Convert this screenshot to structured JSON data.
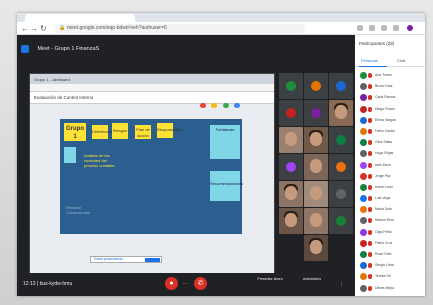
{
  "browser": {
    "url": "meet.google.com/eqp-bdwd-heh?authuser=0",
    "tab_title": "Meet - Grupo 1 FinanzaS"
  },
  "meet": {
    "title": "Meet - Grupo 1 FinanzaS",
    "meeting_code": "12:13 | bus-kydw-hmu",
    "controls": {
      "mic_icon": "mic-off-icon",
      "leave_icon": "call-end-icon",
      "cam_icon": "videocam-off-icon",
      "present_label": "Presentar ahora",
      "activities_label": "Actividades"
    },
    "shared_doc": {
      "window_title": "Grupo 1 - Jamboard",
      "doc_title": "Evaluación de Control Interno"
    },
    "board": {
      "group_label": "Grupo 1",
      "notes": [
        "Deficiencias",
        "Riesgos",
        "Plan de acción",
        "Responsables"
      ],
      "body_lines": [
        "Análisis de los",
        "controles del",
        "proceso contable"
      ],
      "footer_lines": [
        "Revisión",
        "Conclusiones"
      ],
      "right_panel_top": "Fortalezas",
      "right_panel_bottom": "Recomendaciones"
    },
    "share_bar": {
      "text": "Estás presentando",
      "stop_label": "Dejar"
    }
  },
  "participants": {
    "header": "Participantes (28)",
    "tabs": [
      "Personas",
      "Chat"
    ],
    "list": [
      {
        "name": "Ana Torres",
        "color": "#1e8e3e"
      },
      {
        "name": "Bruno Díaz",
        "color": "#5f6368"
      },
      {
        "name": "Carla Ramos",
        "color": "#7b1fa2"
      },
      {
        "name": "Diego Flores",
        "color": "#c5221f"
      },
      {
        "name": "Elena Vargas",
        "color": "#1967d2"
      },
      {
        "name": "Fabio Castro",
        "color": "#e37400"
      },
      {
        "name": "Gina Salas",
        "color": "#0b8043"
      },
      {
        "name": "Hugo Rojas",
        "color": "#5f6368"
      },
      {
        "name": "Inés Mora",
        "color": "#a142f4"
      },
      {
        "name": "Jorge Paz",
        "color": "#d93025"
      },
      {
        "name": "Karen León",
        "color": "#188038"
      },
      {
        "name": "Luis Vega",
        "color": "#1a73e8"
      },
      {
        "name": "María Soto",
        "color": "#e8710a"
      },
      {
        "name": "Nelson Ríos",
        "color": "#5f6368"
      },
      {
        "name": "Olga Peña",
        "color": "#9334e6"
      },
      {
        "name": "Pablo Cruz",
        "color": "#c5221f"
      },
      {
        "name": "Rosa Ortiz",
        "color": "#0b8043"
      },
      {
        "name": "Sergio Lima",
        "color": "#1967d2"
      },
      {
        "name": "Teresa Gil",
        "color": "#e37400"
      },
      {
        "name": "Ulises Mejía",
        "color": "#5f6368"
      }
    ]
  },
  "colors": {
    "meet_bg": "#202124",
    "accent": "#1a73e8",
    "danger": "#d93025",
    "board": "#2b5f8f",
    "sticky": "#ffe234",
    "cyan_note": "#7fd6e6"
  }
}
